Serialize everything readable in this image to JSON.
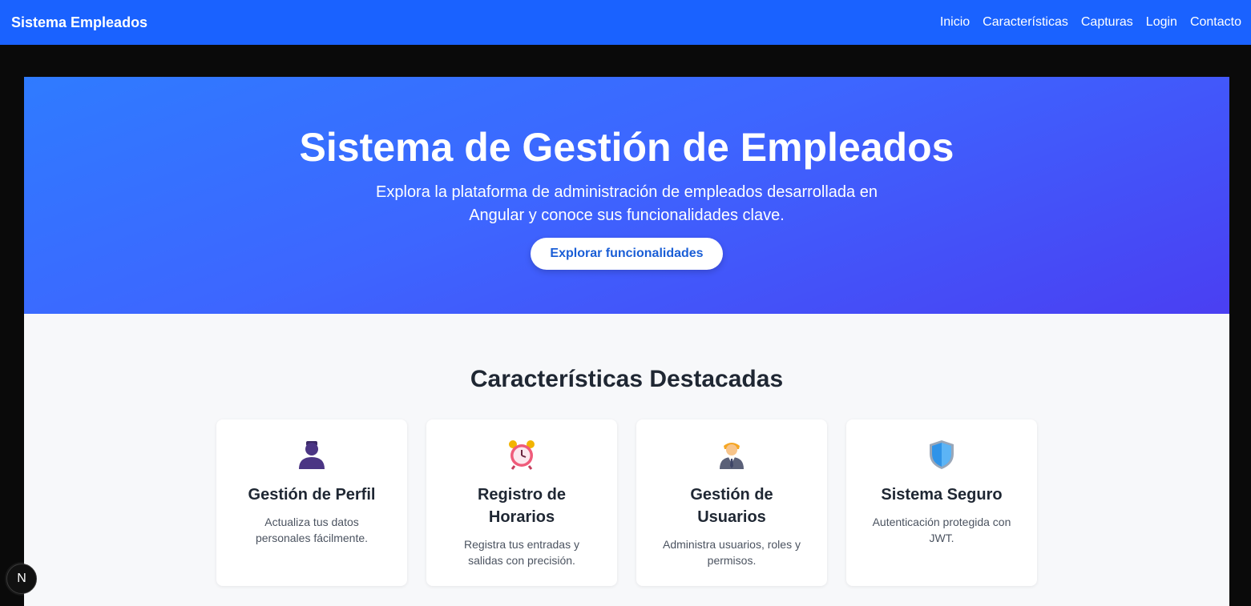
{
  "navbar": {
    "brand": "Sistema Empleados",
    "links": [
      "Inicio",
      "Características",
      "Capturas",
      "Login",
      "Contacto"
    ]
  },
  "hero": {
    "title": "Sistema de Gestión de Empleados",
    "subtitle": "Explora la plataforma de administración de empleados desarrollada en Angular y conoce sus funcionalidades clave.",
    "button_label": "Explorar funcionalidades"
  },
  "features": {
    "heading": "Características Destacadas",
    "cards": [
      {
        "icon": "person-silhouette-icon",
        "title": "Gestión de Perfil",
        "description": "Actualiza tus datos personales fácilmente."
      },
      {
        "icon": "alarm-clock-icon",
        "title": "Registro de Horarios",
        "description": "Registra tus entradas y salidas con precisión."
      },
      {
        "icon": "office-worker-icon",
        "title": "Gestión de Usuarios",
        "description": "Administra usuarios, roles y permisos."
      },
      {
        "icon": "shield-icon",
        "title": "Sistema Seguro",
        "description": "Autenticación protegida con JWT."
      }
    ]
  },
  "badge": {
    "label": "N"
  },
  "colors": {
    "navbar": "#1a62ff",
    "hero_start": "#2f7bff",
    "hero_end": "#4a3ff2",
    "button_text": "#1a5ed6"
  }
}
